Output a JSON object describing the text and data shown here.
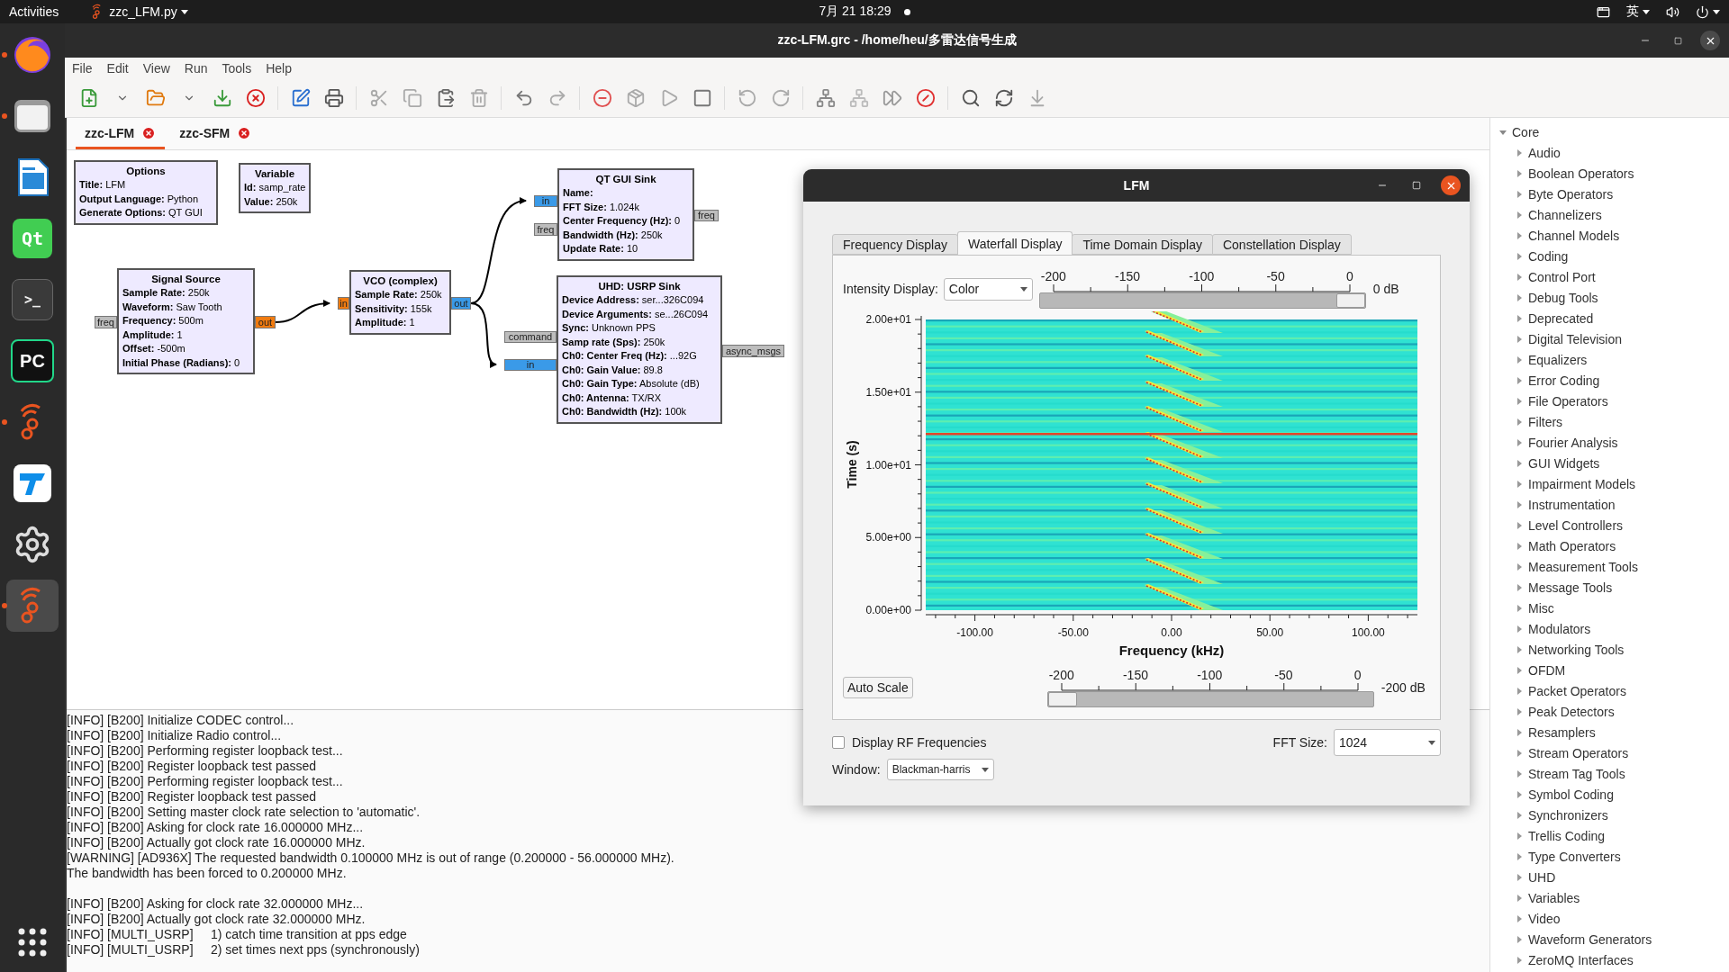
{
  "top_bar": {
    "activities": "Activities",
    "app_menu": "zzc_LFM.py",
    "clock": "7月 21 18:29",
    "input_method": "英"
  },
  "dock": [
    {
      "kind": "browser",
      "running": true,
      "selected": false
    },
    {
      "kind": "files",
      "running": true,
      "selected": false
    },
    {
      "kind": "writer",
      "running": false,
      "selected": false
    },
    {
      "kind": "qt",
      "glyph": "Qt",
      "running": false,
      "selected": false
    },
    {
      "kind": "terminal",
      "glyph": ">_",
      "running": false,
      "selected": false
    },
    {
      "kind": "pycharm",
      "glyph": "PC",
      "running": false,
      "selected": false
    },
    {
      "kind": "radio",
      "running": true,
      "selected": false
    },
    {
      "kind": "remote",
      "running": false,
      "selected": false
    },
    {
      "kind": "settings",
      "running": false,
      "selected": false
    },
    {
      "kind": "radio",
      "running": true,
      "selected": true
    }
  ],
  "window": {
    "title": "zzc-LFM.grc - /home/heu/多雷达信号生成",
    "menu": [
      "File",
      "Edit",
      "View",
      "Run",
      "Tools",
      "Help"
    ],
    "tabs": [
      {
        "label": "zzc-LFM",
        "selected": true
      },
      {
        "label": "zzc-SFM",
        "selected": false
      }
    ],
    "blocks": [
      {
        "title": "Options",
        "params": [
          "**Title:** LFM",
          "**Output Language:** Python",
          "**Generate Options:** QT GUI"
        ]
      },
      {
        "title": "Variable",
        "params": [
          "**Id:** samp_rate",
          "**Value:** 250k"
        ]
      },
      {
        "title": "Signal Source",
        "params": [
          "**Sample Rate:** 250k",
          "**Waveform:** Saw Tooth",
          "**Frequency:** 500m",
          "**Amplitude:** 1",
          "**Offset:** -500m",
          "**Initial Phase (Radians):** 0"
        ],
        "ports": [
          {
            "label": "freq",
            "kind": "message"
          },
          {
            "label": "out",
            "kind": "float"
          }
        ]
      },
      {
        "title": "VCO (complex)",
        "params": [
          "**Sample Rate:** 250k",
          "**Sensitivity:** 155k",
          "**Amplitude:** 1"
        ],
        "ports": [
          {
            "label": "in",
            "kind": "float"
          },
          {
            "label": "out",
            "kind": "complex"
          }
        ]
      },
      {
        "title": "QT GUI Sink",
        "params": [
          "**Name:**",
          "**FFT Size:** 1.024k",
          "**Center Frequency (Hz):** 0",
          "**Bandwidth (Hz):** 250k",
          "**Update Rate:** 10"
        ],
        "ports": [
          {
            "label": "in",
            "kind": "complex"
          },
          {
            "label": "freq",
            "kind": "message"
          },
          {
            "label": "freq",
            "kind": "message"
          }
        ]
      },
      {
        "title": "UHD: USRP Sink",
        "params": [
          "**Device Address:** ser...326C094",
          "**Device Arguments:** se...26C094",
          "**Sync:** Unknown PPS",
          "**Samp rate (Sps):** 250k",
          "**Ch0: Center Freq (Hz):** ...92G",
          "**Ch0: Gain Value:** 89.8",
          "**Ch0: Gain Type:** Absolute (dB)",
          "**Ch0: Antenna:** TX/RX",
          "**Ch0: Bandwidth (Hz):** 100k"
        ],
        "ports": [
          {
            "label": "command",
            "kind": "message"
          },
          {
            "label": "in",
            "kind": "complex"
          },
          {
            "label": "async_msgs",
            "kind": "message"
          }
        ]
      }
    ],
    "log": [
      {
        "text": "[INFO] [B200] Initialize CODEC control...",
        "gap_before": false
      },
      {
        "text": "[INFO] [B200] Initialize Radio control...",
        "gap_before": false
      },
      {
        "text": "[INFO] [B200] Performing register loopback test...",
        "gap_before": false
      },
      {
        "text": "[INFO] [B200] Register loopback test passed",
        "gap_before": false
      },
      {
        "text": "[INFO] [B200] Performing register loopback test...",
        "gap_before": false
      },
      {
        "text": "[INFO] [B200] Register loopback test passed",
        "gap_before": false
      },
      {
        "text": "[INFO] [B200] Setting master clock rate selection to 'automatic'.",
        "gap_before": false
      },
      {
        "text": "[INFO] [B200] Asking for clock rate 16.000000 MHz...",
        "gap_before": false
      },
      {
        "text": "[INFO] [B200] Actually got clock rate 16.000000 MHz.",
        "gap_before": false
      },
      {
        "text": "[WARNING] [AD936X] The requested bandwidth 0.100000 MHz is out of range (0.200000 - 56.000000 MHz).",
        "gap_before": false
      },
      {
        "text": "The bandwidth has been forced to 0.200000 MHz.",
        "gap_before": false
      },
      {
        "text": "[INFO] [B200] Asking for clock rate 32.000000 MHz...",
        "gap_before": true
      },
      {
        "text": "[INFO] [B200] Actually got clock rate 32.000000 MHz.",
        "gap_before": false
      },
      {
        "text": "[INFO] [MULTI_USRP]     1) catch time transition at pps edge",
        "gap_before": false
      },
      {
        "text": "[INFO] [MULTI_USRP]     2) set times next pps (synchronously)",
        "gap_before": false
      }
    ],
    "tree": [
      {
        "label": "Core",
        "expanded": true,
        "children": [
          {
            "label": "Audio",
            "expanded": false
          },
          {
            "label": "Boolean Operators",
            "expanded": false
          },
          {
            "label": "Byte Operators",
            "expanded": false
          },
          {
            "label": "Channelizers",
            "expanded": false
          },
          {
            "label": "Channel Models",
            "expanded": false
          },
          {
            "label": "Coding",
            "expanded": false
          },
          {
            "label": "Control Port",
            "expanded": false
          },
          {
            "label": "Debug Tools",
            "expanded": false
          },
          {
            "label": "Deprecated",
            "expanded": false
          },
          {
            "label": "Digital Television",
            "expanded": false
          },
          {
            "label": "Equalizers",
            "expanded": false
          },
          {
            "label": "Error Coding",
            "expanded": false
          },
          {
            "label": "File Operators",
            "expanded": false
          },
          {
            "label": "Filters",
            "expanded": false
          },
          {
            "label": "Fourier Analysis",
            "expanded": false
          },
          {
            "label": "GUI Widgets",
            "expanded": false
          },
          {
            "label": "Impairment Models",
            "expanded": false
          },
          {
            "label": "Instrumentation",
            "expanded": false
          },
          {
            "label": "Level Controllers",
            "expanded": false
          },
          {
            "label": "Math Operators",
            "expanded": false
          },
          {
            "label": "Measurement Tools",
            "expanded": false
          },
          {
            "label": "Message Tools",
            "expanded": false
          },
          {
            "label": "Misc",
            "expanded": false
          },
          {
            "label": "Modulators",
            "expanded": false
          },
          {
            "label": "Networking Tools",
            "expanded": false
          },
          {
            "label": "OFDM",
            "expanded": false
          },
          {
            "label": "Packet Operators",
            "expanded": false
          },
          {
            "label": "Peak Detectors",
            "expanded": false
          },
          {
            "label": "Resamplers",
            "expanded": false
          },
          {
            "label": "Stream Operators",
            "expanded": false
          },
          {
            "label": "Stream Tag Tools",
            "expanded": false
          },
          {
            "label": "Symbol Coding",
            "expanded": false
          },
          {
            "label": "Synchronizers",
            "expanded": false
          },
          {
            "label": "Trellis Coding",
            "expanded": false
          },
          {
            "label": "Type Converters",
            "expanded": false
          },
          {
            "label": "UHD",
            "expanded": false
          },
          {
            "label": "Variables",
            "expanded": false
          },
          {
            "label": "Video",
            "expanded": false
          },
          {
            "label": "Waveform Generators",
            "expanded": false
          },
          {
            "label": "ZeroMQ Interfaces",
            "expanded": false
          }
        ]
      }
    ]
  },
  "plot_window": {
    "title": "LFM",
    "tabs": [
      {
        "label": "Frequency Display",
        "selected": false
      },
      {
        "label": "Waterfall Display",
        "selected": true
      },
      {
        "label": "Time Domain Display",
        "selected": false
      },
      {
        "label": "Constellation Display",
        "selected": false
      }
    ],
    "intensity": {
      "label": "Intensity Display:",
      "value": "Color"
    },
    "top_slider": {
      "scale": [
        "-200",
        "-150",
        "-100",
        "-50",
        "0"
      ],
      "level": 1,
      "reading": "0 dB"
    },
    "plot": {
      "ylabel": "Time (s)",
      "xlabel": "Frequency (kHz)",
      "yticks": [
        "2.00e+01",
        "1.50e+01",
        "1.00e+01",
        "5.00e+00",
        "0.00e+00"
      ],
      "xticks": [
        "-100.00",
        "-50.00",
        "0.00",
        "50.00",
        "100.00"
      ]
    },
    "auto_scale": "Auto Scale",
    "bottom_slider": {
      "scale": [
        "-200",
        "-150",
        "-100",
        "-50",
        "0"
      ],
      "level": 0,
      "reading": "-200 dB"
    },
    "rf_frequencies": {
      "label": "Display RF Frequencies",
      "checked": false
    },
    "fft_size": {
      "label": "FFT Size:",
      "value": "1024"
    },
    "window_fn": {
      "label": "Window:",
      "value": "Blackman-harris"
    }
  }
}
